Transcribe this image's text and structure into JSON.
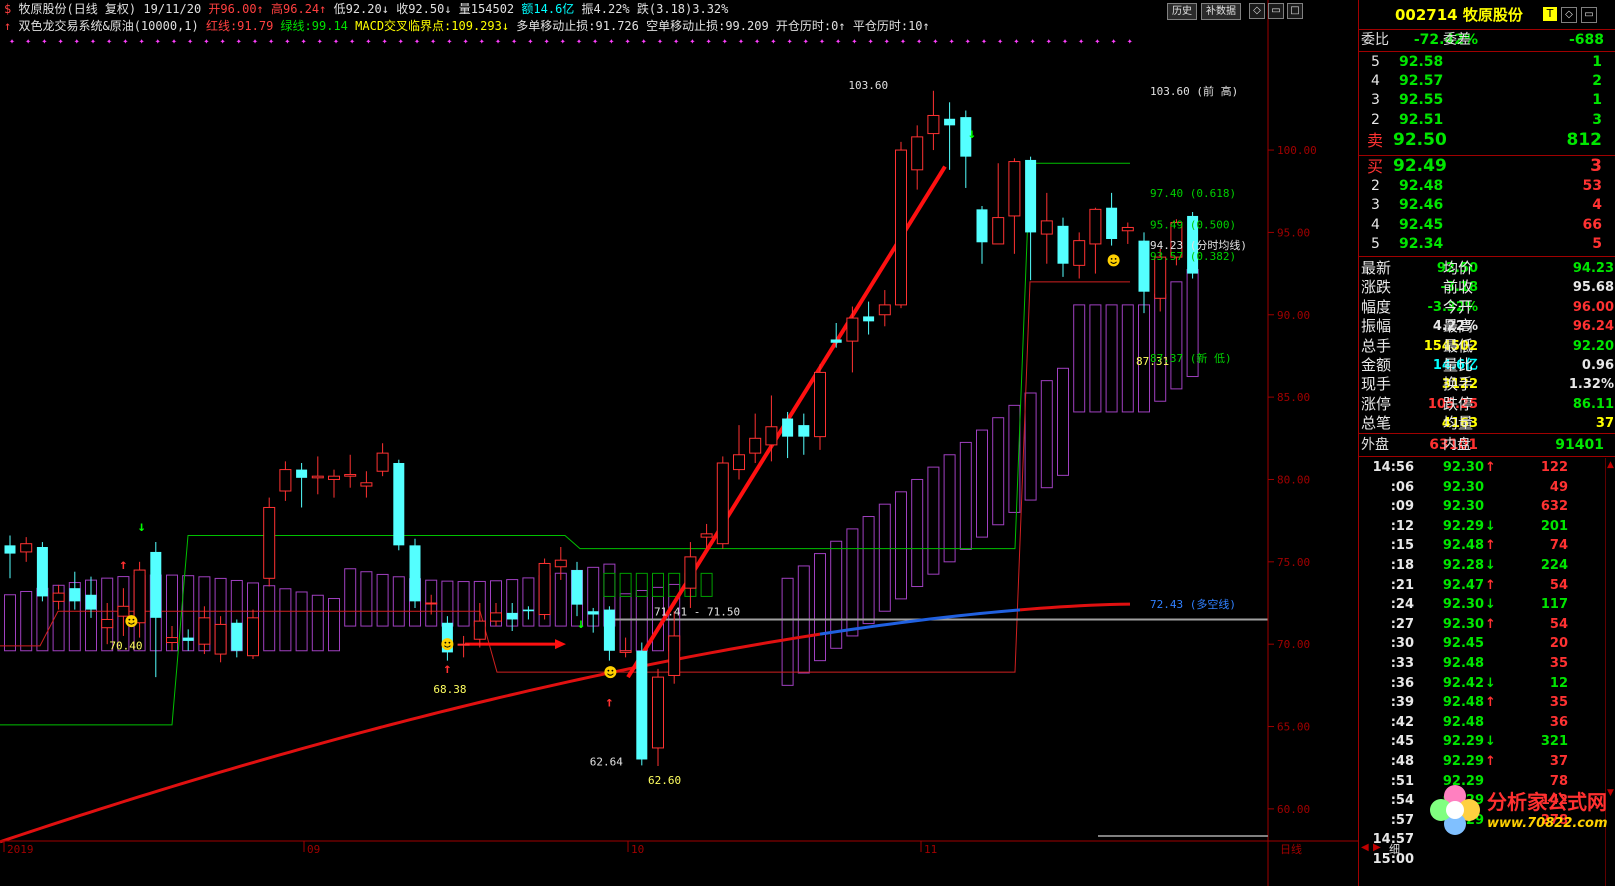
{
  "header": {
    "title": "牧原股份(日线 复权)",
    "date": "19/11/20",
    "open": "开96.00↑",
    "high": "高96.24↑",
    "low": "低92.20↓",
    "close": "收92.50↓",
    "volume": "量154502",
    "amount": "额14.6亿",
    "amplitude": "振4.22%",
    "change": "跌(3.18)3.32%",
    "indicator_name": "双色龙交易系统&原油(10000,1)",
    "red_line": "红线:91.79",
    "green_line": "绿线:99.14",
    "macd": "MACD交叉临界点:109.293↓",
    "long_stop": "多单移动止损:91.726",
    "short_stop": "空单移动止损:99.209",
    "open_pos": "开仓历时:0↑",
    "close_pos": "平仓历时:10↑"
  },
  "toolbar": {
    "history_label": "历史",
    "fq_label": "补数据"
  },
  "chart_data": {
    "type": "candlestick",
    "ylim": [
      57.2,
      106.5
    ],
    "yticks": [
      "100.00",
      "95.00",
      "90.00",
      "85.00",
      "80.00",
      "75.00",
      "70.00",
      "65.00",
      "60.00"
    ],
    "xlabels": [
      "2019",
      "09",
      "10",
      "11"
    ],
    "bottom_label": "日线",
    "candles": [
      {
        "o": 76.0,
        "c": 75.5,
        "h": 76.6,
        "l": 74.0
      },
      {
        "o": 75.6,
        "c": 76.1,
        "h": 76.5,
        "l": 75.0
      },
      {
        "o": 75.9,
        "c": 72.9,
        "h": 76.2,
        "l": 72.6
      },
      {
        "o": 72.6,
        "c": 73.1,
        "h": 73.6,
        "l": 72.1
      },
      {
        "o": 73.4,
        "c": 72.6,
        "h": 74.4,
        "l": 72.1
      },
      {
        "o": 73.0,
        "c": 72.1,
        "h": 74.1,
        "l": 71.6
      },
      {
        "o": 71.0,
        "c": 71.5,
        "h": 72.5,
        "l": 70.0
      },
      {
        "o": 71.7,
        "c": 72.3,
        "h": 73.4,
        "l": 70.5
      },
      {
        "o": 71.3,
        "c": 74.5,
        "h": 75.0,
        "l": 70.4
      },
      {
        "o": 75.6,
        "c": 71.6,
        "h": 76.2,
        "l": 68.0
      },
      {
        "o": 70.1,
        "c": 70.4,
        "h": 71.1,
        "l": 69.6
      },
      {
        "o": 70.4,
        "c": 70.2,
        "h": 70.9,
        "l": 69.6
      },
      {
        "o": 70.0,
        "c": 71.6,
        "h": 72.3,
        "l": 69.4
      },
      {
        "o": 69.4,
        "c": 71.2,
        "h": 71.7,
        "l": 68.9
      },
      {
        "o": 71.3,
        "c": 69.6,
        "h": 71.5,
        "l": 69.2
      },
      {
        "o": 69.3,
        "c": 71.6,
        "h": 72.1,
        "l": 69.1
      },
      {
        "o": 74.0,
        "c": 78.3,
        "h": 78.9,
        "l": 73.5
      },
      {
        "o": 79.3,
        "c": 80.6,
        "h": 81.1,
        "l": 78.7
      },
      {
        "o": 80.6,
        "c": 80.1,
        "h": 81.0,
        "l": 78.3
      },
      {
        "o": 80.1,
        "c": 80.2,
        "h": 81.4,
        "l": 79.1
      },
      {
        "o": 80.0,
        "c": 80.2,
        "h": 80.6,
        "l": 78.9
      },
      {
        "o": 80.2,
        "c": 80.3,
        "h": 81.5,
        "l": 79.5
      },
      {
        "o": 79.6,
        "c": 79.8,
        "h": 80.5,
        "l": 78.9
      },
      {
        "o": 80.5,
        "c": 81.6,
        "h": 82.2,
        "l": 80.2
      },
      {
        "o": 81.0,
        "c": 76.0,
        "h": 81.2,
        "l": 75.7
      },
      {
        "o": 76.0,
        "c": 72.6,
        "h": 76.4,
        "l": 72.2
      },
      {
        "o": 72.5,
        "c": 72.5,
        "h": 73.0,
        "l": 71.8
      },
      {
        "o": 71.3,
        "c": 69.5,
        "h": 71.7,
        "l": 69.0
      },
      {
        "o": 70.0,
        "c": 70.0,
        "h": 70.5,
        "l": 69.2
      },
      {
        "o": 70.3,
        "c": 71.4,
        "h": 72.5,
        "l": 69.8
      },
      {
        "o": 71.4,
        "c": 71.9,
        "h": 72.5,
        "l": 71.1
      },
      {
        "o": 71.9,
        "c": 71.5,
        "h": 72.5,
        "l": 70.8
      },
      {
        "o": 72.1,
        "c": 72.0,
        "h": 72.3,
        "l": 71.5
      },
      {
        "o": 71.8,
        "c": 74.9,
        "h": 75.2,
        "l": 71.5
      },
      {
        "o": 74.7,
        "c": 75.1,
        "h": 75.9,
        "l": 73.9
      },
      {
        "o": 74.5,
        "c": 72.4,
        "h": 75.0,
        "l": 71.7
      },
      {
        "o": 72.0,
        "c": 71.8,
        "h": 72.2,
        "l": 70.7
      },
      {
        "o": 72.1,
        "c": 69.6,
        "h": 72.3,
        "l": 69.0
      },
      {
        "o": 69.5,
        "c": 69.6,
        "h": 70.4,
        "l": 69.2
      },
      {
        "o": 69.6,
        "c": 63.0,
        "h": 70.1,
        "l": 62.64
      },
      {
        "o": 63.7,
        "c": 68.0,
        "h": 68.5,
        "l": 62.6
      },
      {
        "o": 68.1,
        "c": 70.5,
        "h": 72.0,
        "l": 67.6
      },
      {
        "o": 73.4,
        "c": 75.3,
        "h": 76.2,
        "l": 72.2
      },
      {
        "o": 76.5,
        "c": 76.7,
        "h": 77.3,
        "l": 75.8
      },
      {
        "o": 76.1,
        "c": 81.0,
        "h": 81.4,
        "l": 75.8
      },
      {
        "o": 80.6,
        "c": 81.5,
        "h": 83.3,
        "l": 80.0
      },
      {
        "o": 81.6,
        "c": 82.5,
        "h": 84.0,
        "l": 81.0
      },
      {
        "o": 82.1,
        "c": 83.2,
        "h": 85.1,
        "l": 81.1
      },
      {
        "o": 83.7,
        "c": 82.6,
        "h": 84.1,
        "l": 81.3
      },
      {
        "o": 83.3,
        "c": 82.6,
        "h": 84.0,
        "l": 81.5
      },
      {
        "o": 82.6,
        "c": 86.5,
        "h": 87.0,
        "l": 81.8
      },
      {
        "o": 88.5,
        "c": 88.3,
        "h": 89.5,
        "l": 88.0
      },
      {
        "o": 88.4,
        "c": 89.8,
        "h": 90.5,
        "l": 86.5
      },
      {
        "o": 89.9,
        "c": 89.6,
        "h": 90.8,
        "l": 88.8
      },
      {
        "o": 90.0,
        "c": 90.6,
        "h": 91.5,
        "l": 89.3
      },
      {
        "o": 90.6,
        "c": 100.0,
        "h": 100.5,
        "l": 90.4
      },
      {
        "o": 98.8,
        "c": 100.8,
        "h": 101.5,
        "l": 97.6
      },
      {
        "o": 101.0,
        "c": 102.1,
        "h": 103.6,
        "l": 100.0
      },
      {
        "o": 101.9,
        "c": 101.5,
        "h": 102.9,
        "l": 98.8
      },
      {
        "o": 102.0,
        "c": 99.6,
        "h": 102.4,
        "l": 97.7
      },
      {
        "o": 96.4,
        "c": 94.4,
        "h": 96.6,
        "l": 93.1
      },
      {
        "o": 94.3,
        "c": 95.9,
        "h": 99.2,
        "l": 94.3
      },
      {
        "o": 96.0,
        "c": 99.3,
        "h": 99.5,
        "l": 93.7
      },
      {
        "o": 99.4,
        "c": 95.0,
        "h": 99.6,
        "l": 92.1
      },
      {
        "o": 94.9,
        "c": 95.7,
        "h": 97.4,
        "l": 93.1
      },
      {
        "o": 95.4,
        "c": 93.1,
        "h": 95.9,
        "l": 92.3
      },
      {
        "o": 93.0,
        "c": 94.5,
        "h": 95.0,
        "l": 92.2
      },
      {
        "o": 94.3,
        "c": 96.4,
        "h": 96.5,
        "l": 92.5
      },
      {
        "o": 96.5,
        "c": 94.6,
        "h": 97.4,
        "l": 94.2
      },
      {
        "o": 95.1,
        "c": 95.3,
        "h": 95.6,
        "l": 94.3
      },
      {
        "o": 94.5,
        "c": 91.4,
        "h": 95.0,
        "l": 90.1
      },
      {
        "o": 91.0,
        "c": 93.5,
        "h": 94.0,
        "l": 90.2
      },
      {
        "o": 93.5,
        "c": 95.6,
        "h": 95.8,
        "l": 93.0
      },
      {
        "o": 96.0,
        "c": 92.5,
        "h": 96.24,
        "l": 92.2
      }
    ],
    "annotations": [
      {
        "text": "103.60",
        "kind": "high"
      },
      {
        "text": "70.40",
        "kind": "low"
      },
      {
        "text": "68.38",
        "kind": "low"
      },
      {
        "text": "62.64",
        "kind": "low"
      },
      {
        "text": "62.60",
        "kind": "low"
      },
      {
        "text": "71.41 - 71.50",
        "kind": "range"
      },
      {
        "text": "87.31",
        "kind": "low"
      }
    ],
    "right_labels": [
      {
        "text": "103.60 (前 高)",
        "value": 103.6,
        "color": "#e0e0e0"
      },
      {
        "text": "97.40 (0.618)",
        "value": 97.4,
        "color": "#00d000"
      },
      {
        "text": "95.49 (0.500)",
        "value": 95.49,
        "color": "#00d000"
      },
      {
        "text": "94.23  (分时均线)",
        "value": 94.23,
        "color": "#e0e0e0"
      },
      {
        "text": "93.57 (0.382)",
        "value": 93.57,
        "color": "#00d000"
      },
      {
        "text": "87.37 (新 低)",
        "value": 87.37,
        "color": "#00d000"
      },
      {
        "text": "72.43  (多空线)",
        "value": 72.43,
        "color": "#3080ff"
      }
    ]
  },
  "panel": {
    "code_name": "002714 牧原股份",
    "t_label": "T",
    "wb_label": "委比",
    "wb_value": "-72.42%",
    "wc_label": "委差",
    "wc_value": "-688",
    "asks": [
      {
        "lvl": "5",
        "price": "92.58",
        "vol": "1"
      },
      {
        "lvl": "4",
        "price": "92.57",
        "vol": "2"
      },
      {
        "lvl": "3",
        "price": "92.55",
        "vol": "1"
      },
      {
        "lvl": "2",
        "price": "92.51",
        "vol": "3"
      },
      {
        "lvl": "卖",
        "price": "92.50",
        "vol": "812"
      }
    ],
    "bids": [
      {
        "lvl": "买",
        "price": "92.49",
        "vol": "3"
      },
      {
        "lvl": "2",
        "price": "92.48",
        "vol": "53"
      },
      {
        "lvl": "3",
        "price": "92.46",
        "vol": "4"
      },
      {
        "lvl": "4",
        "price": "92.45",
        "vol": "66"
      },
      {
        "lvl": "5",
        "price": "92.34",
        "vol": "5"
      }
    ],
    "stats": [
      {
        "l1": "最新",
        "v1": "92.50",
        "c1": "grn",
        "l2": "均价",
        "v2": "94.23",
        "c2": "grn"
      },
      {
        "l1": "涨跌",
        "v1": "-3.18",
        "c1": "grn",
        "l2": "前收",
        "v2": "95.68",
        "c2": "wht"
      },
      {
        "l1": "幅度",
        "v1": "-3.32%",
        "c1": "grn",
        "l2": "今开",
        "v2": "96.00",
        "c2": "red"
      },
      {
        "l1": "振幅",
        "v1": "4.22%",
        "c1": "wht",
        "l2": "最高",
        "v2": "96.24",
        "c2": "red"
      },
      {
        "l1": "总手",
        "v1": "154502",
        "c1": "yel",
        "l2": "最低",
        "v2": "92.20",
        "c2": "grn"
      },
      {
        "l1": "金额",
        "v1": "14.6亿",
        "c1": "cyn",
        "l2": "量比",
        "v2": "0.96",
        "c2": "wht"
      },
      {
        "l1": "现手",
        "v1": "3122",
        "c1": "yel",
        "l2": "换手",
        "v2": "1.32%",
        "c2": "wht"
      },
      {
        "l1": "涨停",
        "v1": "105.25",
        "c1": "red",
        "l2": "跌停",
        "v2": "86.11",
        "c2": "grn"
      },
      {
        "l1": "总笔",
        "v1": "4163",
        "c1": "yel",
        "l2": "均量",
        "v2": "37",
        "c2": "yel"
      }
    ],
    "outer_label": "外盘",
    "outer_value": "63101",
    "inner_label": "内盘",
    "inner_value": "91401",
    "ticks": [
      {
        "t": "14:56",
        "p": "92.30",
        "pc": "grn",
        "d": "↑",
        "dc": "red",
        "v": "122",
        "vc": "red"
      },
      {
        "t": ":06",
        "p": "92.30",
        "pc": "grn",
        "d": "",
        "dc": "red",
        "v": "49",
        "vc": "red"
      },
      {
        "t": ":09",
        "p": "92.30",
        "pc": "grn",
        "d": "",
        "dc": "red",
        "v": "632",
        "vc": "red"
      },
      {
        "t": ":12",
        "p": "92.29",
        "pc": "grn",
        "d": "↓",
        "dc": "grn",
        "v": "201",
        "vc": "grn"
      },
      {
        "t": ":15",
        "p": "92.48",
        "pc": "grn",
        "d": "↑",
        "dc": "red",
        "v": "74",
        "vc": "red"
      },
      {
        "t": ":18",
        "p": "92.28",
        "pc": "grn",
        "d": "↓",
        "dc": "grn",
        "v": "224",
        "vc": "grn"
      },
      {
        "t": ":21",
        "p": "92.47",
        "pc": "grn",
        "d": "↑",
        "dc": "red",
        "v": "54",
        "vc": "red"
      },
      {
        "t": ":24",
        "p": "92.30",
        "pc": "grn",
        "d": "↓",
        "dc": "grn",
        "v": "117",
        "vc": "grn"
      },
      {
        "t": ":27",
        "p": "92.30",
        "pc": "grn",
        "d": "↑",
        "dc": "red",
        "v": "54",
        "vc": "red"
      },
      {
        "t": ":30",
        "p": "92.45",
        "pc": "grn",
        "d": "",
        "dc": "red",
        "v": "20",
        "vc": "red"
      },
      {
        "t": ":33",
        "p": "92.48",
        "pc": "grn",
        "d": "",
        "dc": "red",
        "v": "35",
        "vc": "red"
      },
      {
        "t": ":36",
        "p": "92.42",
        "pc": "grn",
        "d": "↓",
        "dc": "grn",
        "v": "12",
        "vc": "grn"
      },
      {
        "t": ":39",
        "p": "92.48",
        "pc": "grn",
        "d": "↑",
        "dc": "red",
        "v": "35",
        "vc": "red"
      },
      {
        "t": ":42",
        "p": "92.48",
        "pc": "grn",
        "d": "",
        "dc": "red",
        "v": "36",
        "vc": "red"
      },
      {
        "t": ":45",
        "p": "92.29",
        "pc": "grn",
        "d": "↓",
        "dc": "grn",
        "v": "321",
        "vc": "grn"
      },
      {
        "t": ":48",
        "p": "92.29",
        "pc": "grn",
        "d": "↑",
        "dc": "red",
        "v": "37",
        "vc": "red"
      },
      {
        "t": ":51",
        "p": "92.29",
        "pc": "grn",
        "d": "",
        "dc": "red",
        "v": "78",
        "vc": "red"
      },
      {
        "t": ":54",
        "p": "92.29",
        "pc": "grn",
        "d": "",
        "dc": "red",
        "v": "142",
        "vc": "red"
      },
      {
        "t": ":57",
        "p": "92.29",
        "pc": "grn",
        "d": "",
        "dc": "red",
        "v": "278",
        "vc": "red"
      },
      {
        "t": "14:57",
        "p": "",
        "pc": "grn",
        "d": "",
        "dc": "red",
        "v": "",
        "vc": "red"
      },
      {
        "t": "15:00",
        "p": "",
        "pc": "grn",
        "d": "",
        "dc": "red",
        "v": "",
        "vc": "red"
      }
    ],
    "detail_tab": "细",
    "watermark_site": "分析家公式网",
    "watermark_url": "www.70822.com"
  }
}
